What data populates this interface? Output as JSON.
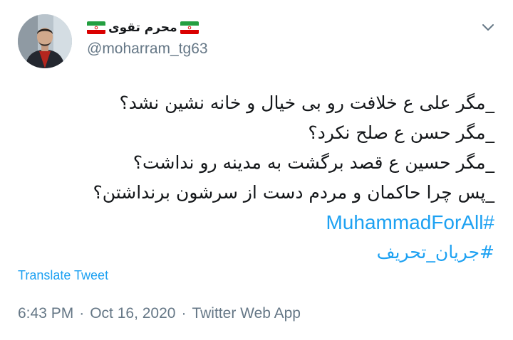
{
  "user": {
    "display_name": "محرم تقوی",
    "handle": "@moharram_tg63"
  },
  "tweet": {
    "lines": [
      "_مگر علی ع خلافت رو بی خیال و خانه نشین نشد؟",
      "_مگر حسن ع صلح نکرد؟",
      "_مگر حسین ع قصد برگشت به مدینه رو نداشت؟",
      "_پس چرا حاکمان و مردم دست از سرشون برنداشتن؟"
    ],
    "hashtags": [
      "#MuhammadForAll",
      "#جریان_تحریف"
    ]
  },
  "translate_label": "Translate Tweet",
  "meta": {
    "time": "6:43 PM",
    "separator": "·",
    "date": "Oct 16, 2020",
    "source": "Twitter Web App"
  },
  "colors": {
    "link": "#1da1f2",
    "muted": "#657786",
    "text": "#14171a"
  },
  "icons": {
    "caret": "chevron-down-icon",
    "flag": "iran-flag-icon"
  }
}
